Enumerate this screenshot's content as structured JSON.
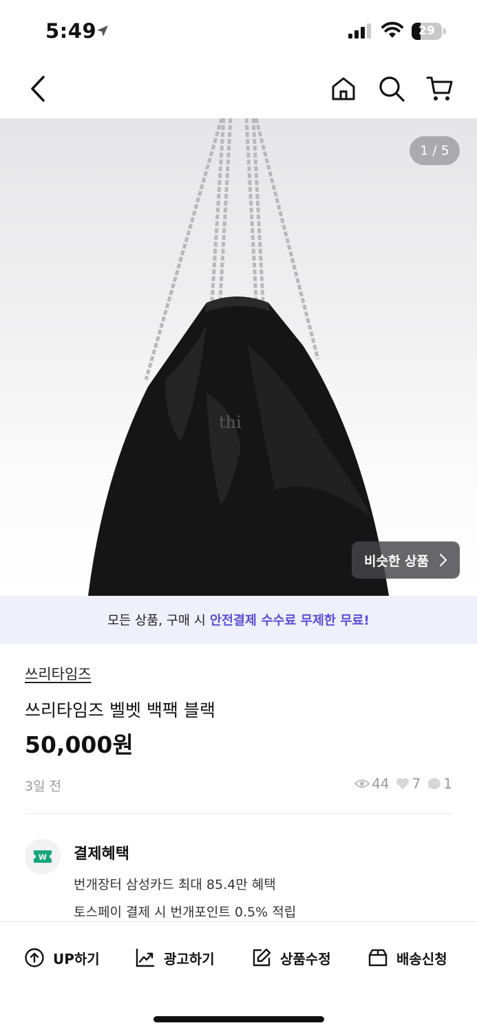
{
  "status_bar": {
    "time": "5:49",
    "battery_level": "29",
    "battery_fraction": 0.29
  },
  "nav": {
    "back_icon": "chevron-left-icon",
    "home_icon": "home-icon",
    "search_icon": "search-icon",
    "cart_icon": "cart-icon"
  },
  "product_image": {
    "counter": "1 / 5",
    "similar_button": "비슷한 상품",
    "colors": {
      "bag": "#151515",
      "chain": "#b9b9bb"
    }
  },
  "promo": {
    "text": "모든 상품, 구매 시",
    "highlight": "안전결제 수수료 무제한 무료!",
    "highlight_color": "#5a4fd9"
  },
  "product": {
    "shop": "쓰리타임즈",
    "title": "쓰리타임즈 벨벳 백팩 블랙",
    "price": "50,000원",
    "posted": "3일 전",
    "views": "44",
    "likes": "7",
    "chats": "1"
  },
  "benefits": {
    "title": "결제혜택",
    "line1": "번개장터 삼성카드 최대 85.4만 혜택",
    "line2": "토스페이 결제 시 번개포인트 0.5% 적립",
    "icon_color": "#18a57b"
  },
  "actions": {
    "up": "UP하기",
    "ad": "광고하기",
    "edit": "상품수정",
    "ship": "배송신청"
  }
}
